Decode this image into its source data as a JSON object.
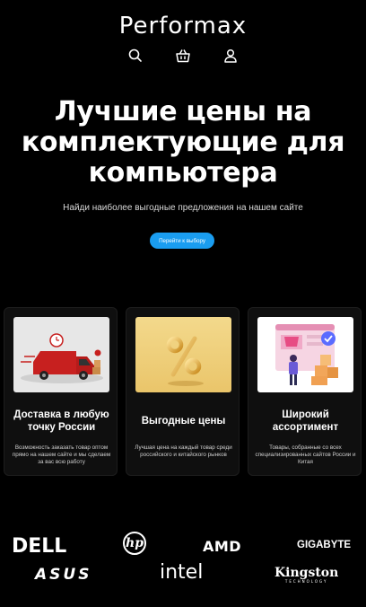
{
  "header": {
    "logo": "Performax",
    "icons": [
      "search-icon",
      "basket-icon",
      "user-icon"
    ]
  },
  "hero": {
    "title": "Лучшие цены на комплектующие для компьютера",
    "subtitle": "Найди наиболее выгодные предложения на нашем сайте",
    "cta_label": "Перейти к выбору"
  },
  "features": [
    {
      "title": "Доставка в любую точку России",
      "description": "Возможность заказать товар оптом прямо на нашем сайте и мы сделаем за вас всю работу",
      "image": "delivery-truck-image"
    },
    {
      "title": "Выгодные цены",
      "description": "Лучшая цена на каждый товар среди российского и китайского рынков",
      "image": "percent-image"
    },
    {
      "title": "Широкий ассортимент",
      "description": "Товары, собранные со всех специализированных сайтов России и Китая",
      "image": "online-store-image"
    }
  ],
  "brands": [
    "DELL",
    "hp",
    "AMD",
    "GIGABYTE",
    "ASUS",
    "intel",
    "Kingston",
    "TECHNOLOGY"
  ],
  "colors": {
    "background": "#000000",
    "accent": "#1a9df0",
    "card_background": "#0f0f0f"
  }
}
